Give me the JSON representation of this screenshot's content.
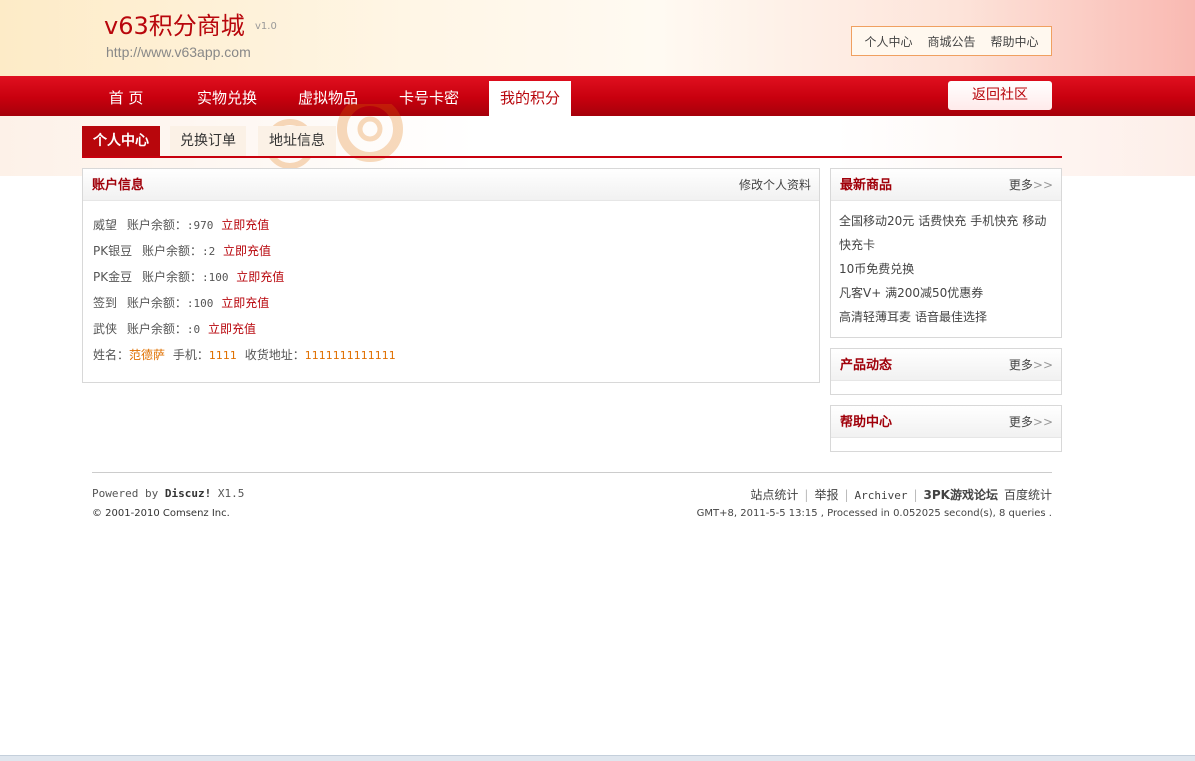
{
  "header": {
    "site_title": "v63积分商城",
    "version": "v1.0",
    "url": "http://www.v63app.com",
    "top_links": [
      "个人中心",
      "商城公告",
      "帮助中心"
    ]
  },
  "nav": {
    "items": [
      "首 页",
      "实物兑换",
      "虚拟物品",
      "卡号卡密",
      "我的积分"
    ],
    "active": "我的积分",
    "return_label": "返回社区"
  },
  "subtabs": {
    "items": [
      "个人中心",
      "兑换订单",
      "地址信息"
    ],
    "active": "个人中心"
  },
  "account": {
    "title": "账户信息",
    "edit_label": "修改个人资料",
    "balance_label": "账户余额：",
    "recharge_label": "立即充值",
    "rows": [
      {
        "name": "威望",
        "value": ":970"
      },
      {
        "name": "PK银豆",
        "value": ":2"
      },
      {
        "name": "PK金豆",
        "value": ":100"
      },
      {
        "name": "签到",
        "value": ":100"
      },
      {
        "name": "武侠",
        "value": ":0"
      }
    ],
    "profile": {
      "name_label": "姓名：",
      "name": "范德萨",
      "phone_label": "手机：",
      "phone": "1111",
      "address_label": "收货地址：",
      "address": "1111111111111"
    }
  },
  "sidebar": {
    "more_label": "更多",
    "latest": {
      "title": "最新商品",
      "items": [
        "全国移动20元",
        "话费快充",
        "手机快充",
        "移动快充卡",
        "10币免费兑换",
        "凡客V+ 满200减50优惠券",
        "高清轻薄耳麦",
        "语音最佳选择"
      ]
    },
    "product_news": {
      "title": "产品动态"
    },
    "help": {
      "title": "帮助中心"
    }
  },
  "footer": {
    "powered_prefix": "Powered by",
    "powered_brand": "Discuz!",
    "powered_version": "X1.5",
    "copyright": "© 2001-2010 Comsenz Inc.",
    "links": [
      "站点统计",
      "举报",
      "Archiver",
      "3PK游戏论坛",
      "百度统计"
    ],
    "debug": "GMT+8, 2011-5-5 13:15 , Processed in 0.052025 second(s), 8 queries ."
  },
  "colors": {
    "brand_red": "#b8060c",
    "nav_red": "#c8000e",
    "accent_orange": "#e07000"
  }
}
